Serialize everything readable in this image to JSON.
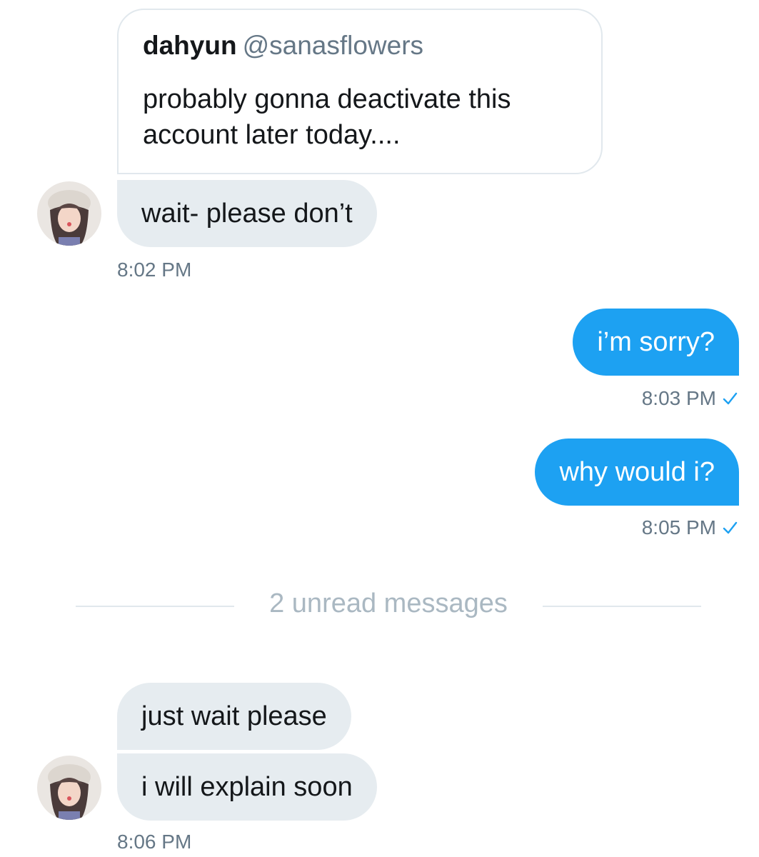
{
  "quoted_tweet": {
    "display_name": "dahyun",
    "handle": "@sanasflowers",
    "text": "probably gonna deactivate this account later today...."
  },
  "messages": [
    {
      "direction": "incoming",
      "text": "wait- please don’t",
      "time": "8:02 PM"
    },
    {
      "direction": "outgoing",
      "text": "i’m sorry?",
      "time": "8:03 PM",
      "status_icon": "checkmark-icon"
    },
    {
      "direction": "outgoing",
      "text": "why would i?",
      "time": "8:05 PM",
      "status_icon": "checkmark-icon"
    },
    {
      "direction": "incoming",
      "text": "just wait please"
    },
    {
      "direction": "incoming",
      "text": "i will explain soon",
      "time": "8:06 PM"
    }
  ],
  "unread_divider": {
    "label": "2 unread messages"
  },
  "colors": {
    "incoming_bubble": "#e6ecf0",
    "outgoing_bubble": "#1da1f2",
    "timestamp": "#657786",
    "divider_text": "#aab8c2",
    "check": "#1da1f2"
  }
}
